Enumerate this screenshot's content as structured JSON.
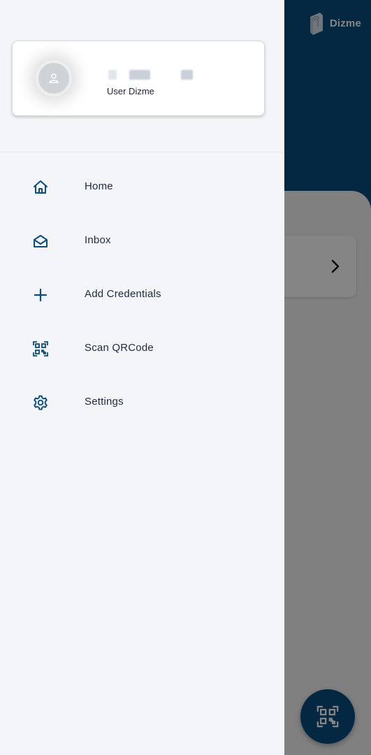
{
  "app": {
    "brand_name": "Dizme",
    "accent_color": "#0a4d7f"
  },
  "drawer": {
    "user": {
      "name": "User Dizme",
      "avatar_icon": "person-icon"
    },
    "menu": [
      {
        "label": "Home",
        "icon": "home-icon"
      },
      {
        "label": "Inbox",
        "icon": "envelope-icon"
      },
      {
        "label": "Add Credentials",
        "icon": "plus-icon"
      },
      {
        "label": "Scan QRCode",
        "icon": "qr-code-icon"
      },
      {
        "label": "Settings",
        "icon": "gear-icon"
      }
    ]
  },
  "background": {
    "card_action_icon": "chevron-right-icon",
    "fab_icon": "qr-code-icon"
  }
}
